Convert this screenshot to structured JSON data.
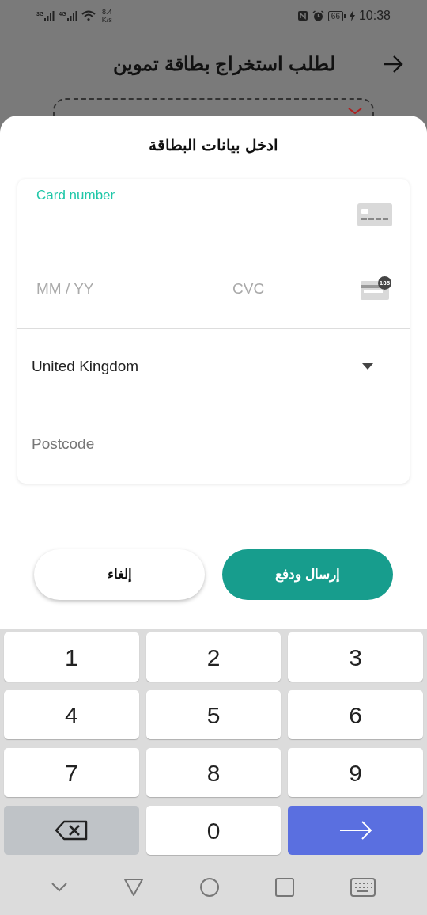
{
  "status_bar": {
    "network_1": "3G",
    "network_2": "4G",
    "speed": "8.4",
    "speed_unit": "K/s",
    "battery": "66",
    "time": "10:38"
  },
  "header": {
    "title": "لطلب استخراج بطاقة تموين"
  },
  "dialog": {
    "title": "ادخل بيانات البطاقة",
    "card_number": {
      "label": "Card number",
      "focused": true
    },
    "expiry": {
      "placeholder": "MM / YY"
    },
    "cvc": {
      "placeholder": "CVC",
      "icon_badge": "135"
    },
    "country": {
      "value": "United Kingdom"
    },
    "postcode": {
      "placeholder": "Postcode"
    },
    "buttons": [
      {
        "label": "إرسال ودفع",
        "kind": "primary"
      },
      {
        "label": "إلغاء",
        "kind": "secondary"
      }
    ]
  },
  "keyboard": {
    "rows": [
      {
        "keys": [
          {
            "label": "3",
            "kind": "digit"
          },
          {
            "label": "2",
            "kind": "digit"
          },
          {
            "label": "1",
            "kind": "digit"
          }
        ]
      },
      {
        "keys": [
          {
            "label": "6",
            "kind": "digit"
          },
          {
            "label": "5",
            "kind": "digit"
          },
          {
            "label": "4",
            "kind": "digit"
          }
        ]
      },
      {
        "keys": [
          {
            "label": "9",
            "kind": "digit"
          },
          {
            "label": "8",
            "kind": "digit"
          },
          {
            "label": "7",
            "kind": "digit"
          }
        ]
      },
      {
        "keys": [
          {
            "kind": "enter"
          },
          {
            "label": "0",
            "kind": "digit"
          },
          {
            "kind": "backspace"
          }
        ]
      }
    ]
  }
}
